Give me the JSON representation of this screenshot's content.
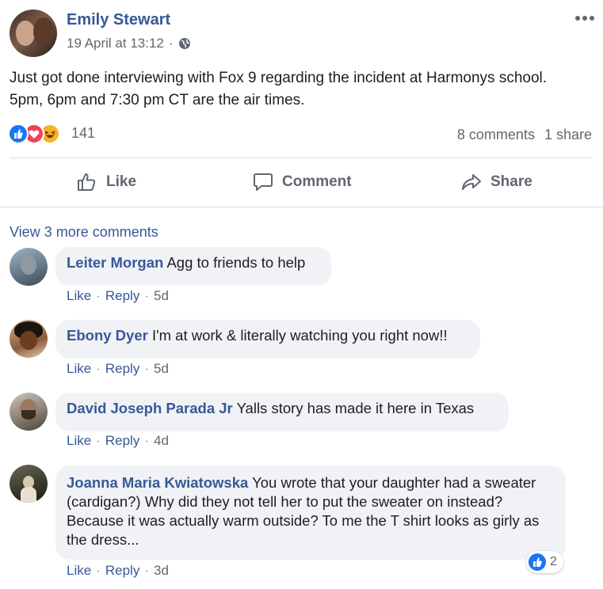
{
  "post": {
    "author": "Emily Stewart",
    "timestamp": "19 April at 13:12",
    "separator": "·",
    "text": "Just got done interviewing with Fox 9 regarding the incident at Harmonys school. 5pm, 6pm and 7:30 pm CT are the air times.",
    "reaction_count": "141",
    "comments_count": "8 comments",
    "shares_count": "1 share",
    "more_icon": "ellipsis-icon",
    "privacy_icon": "globe-icon"
  },
  "actions": {
    "like": "Like",
    "comment": "Comment",
    "share": "Share"
  },
  "comments_section": {
    "view_more": "View 3 more comments",
    "like_label": "Like",
    "reply_label": "Reply",
    "separator": "·",
    "items": [
      {
        "author": "Leiter Morgan",
        "text": "Agg to friends to help",
        "time": "5d"
      },
      {
        "author": "Ebony Dyer",
        "text": "I'm at work & literally watching you right now!!",
        "time": "5d"
      },
      {
        "author": "David Joseph Parada Jr",
        "text": "Yalls story has made it here in Texas",
        "time": "4d"
      },
      {
        "author": "Joanna Maria Kwiatowska",
        "text": "You wrote that your daughter had a sweater (cardigan?) Why did they not tell her to put the sweater on instead? Because it was actually warm outside? To me the T shirt looks as girly as the dress...",
        "time": "3d",
        "reaction_count": "2"
      }
    ]
  },
  "colors": {
    "link": "#385898",
    "like_blue": "#1877f2",
    "love_red": "#f33e58",
    "haha_yellow": "#f7b125",
    "bubble_bg": "#f0f2f5"
  }
}
